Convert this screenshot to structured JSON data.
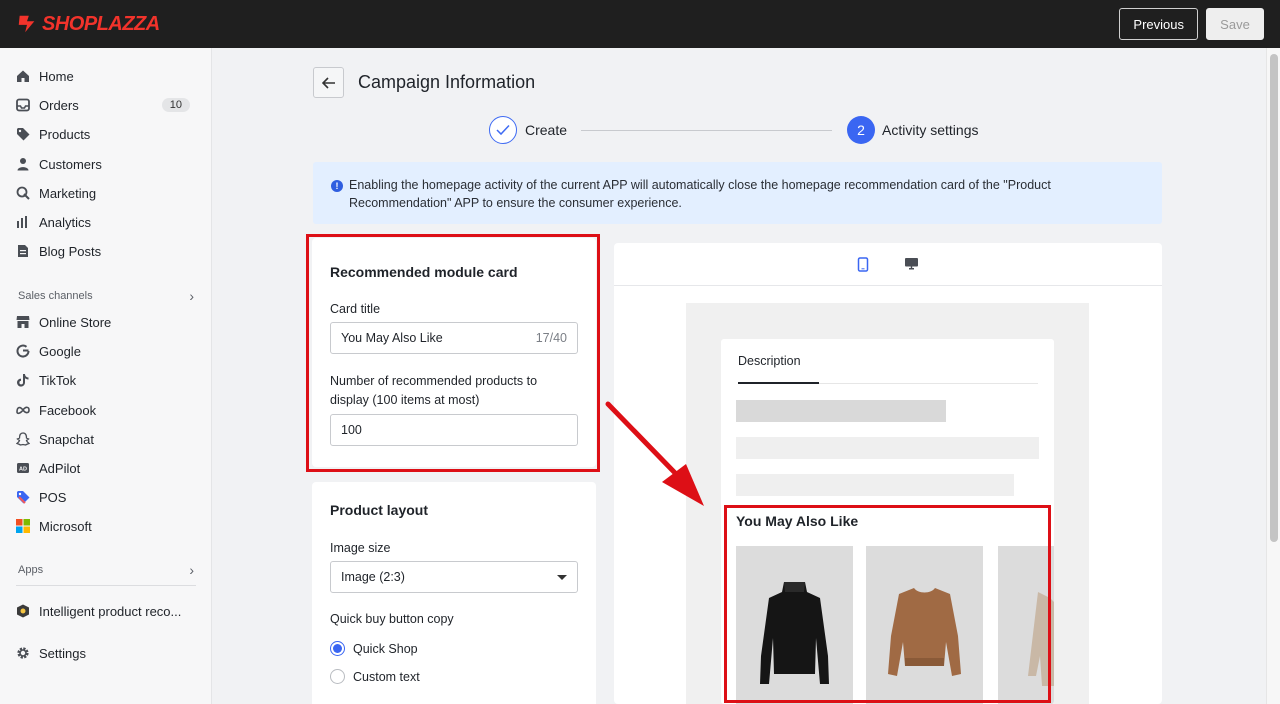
{
  "brand": {
    "name": "SHOPLAZZA",
    "color": "#f2332b"
  },
  "topbar": {
    "previous_label": "Previous",
    "save_label": "Save"
  },
  "sidebar": {
    "items": [
      {
        "label": "Home",
        "icon": "home-icon"
      },
      {
        "label": "Orders",
        "icon": "inbox-icon",
        "badge": "10"
      },
      {
        "label": "Products",
        "icon": "tag-icon"
      },
      {
        "label": "Customers",
        "icon": "person-icon"
      },
      {
        "label": "Marketing",
        "icon": "megaphone-icon"
      },
      {
        "label": "Analytics",
        "icon": "bar-chart-icon"
      },
      {
        "label": "Blog Posts",
        "icon": "document-icon"
      }
    ],
    "sales_channels_label": "Sales channels",
    "channels": [
      {
        "label": "Online Store",
        "icon": "store-icon"
      },
      {
        "label": "Google",
        "icon": "google-icon"
      },
      {
        "label": "TikTok",
        "icon": "tiktok-icon"
      },
      {
        "label": "Facebook",
        "icon": "meta-icon"
      },
      {
        "label": "Snapchat",
        "icon": "ghost-icon"
      },
      {
        "label": "AdPilot",
        "icon": "ad-icon"
      },
      {
        "label": "POS",
        "icon": "pos-tag-icon"
      },
      {
        "label": "Microsoft",
        "icon": "microsoft-icon"
      }
    ],
    "apps_label": "Apps",
    "app_item": {
      "label": "Intelligent product reco...",
      "icon": "app-icon"
    },
    "settings_label": "Settings"
  },
  "page": {
    "title": "Campaign Information",
    "steps": [
      {
        "label": "Create",
        "state": "done"
      },
      {
        "number": "2",
        "label": "Activity settings",
        "state": "active"
      }
    ],
    "alert": "Enabling the homepage activity of the current APP will automatically close the homepage recommendation card of the \"Product Recommendation\" APP to ensure the consumer experience."
  },
  "module_card": {
    "title": "Recommended module card",
    "card_title_label": "Card title",
    "card_title_value": "You May Also Like",
    "card_title_counter": "17/40",
    "count_label": "Number of recommended products to display (100 items at most)",
    "count_value": "100"
  },
  "layout_card": {
    "title": "Product layout",
    "image_size_label": "Image size",
    "image_size_value": "Image (2:3)",
    "quick_buy_label": "Quick buy button copy",
    "options": [
      {
        "label": "Quick Shop",
        "checked": true
      },
      {
        "label": "Custom text",
        "checked": false
      }
    ]
  },
  "preview": {
    "tab_label": "Description",
    "section_title": "You May Also Like",
    "device_icons": [
      "mobile-icon",
      "desktop-icon"
    ]
  },
  "colors": {
    "accent": "#3a66f2",
    "highlight": "#dd0f16",
    "alert_bg": "#e3efff"
  }
}
